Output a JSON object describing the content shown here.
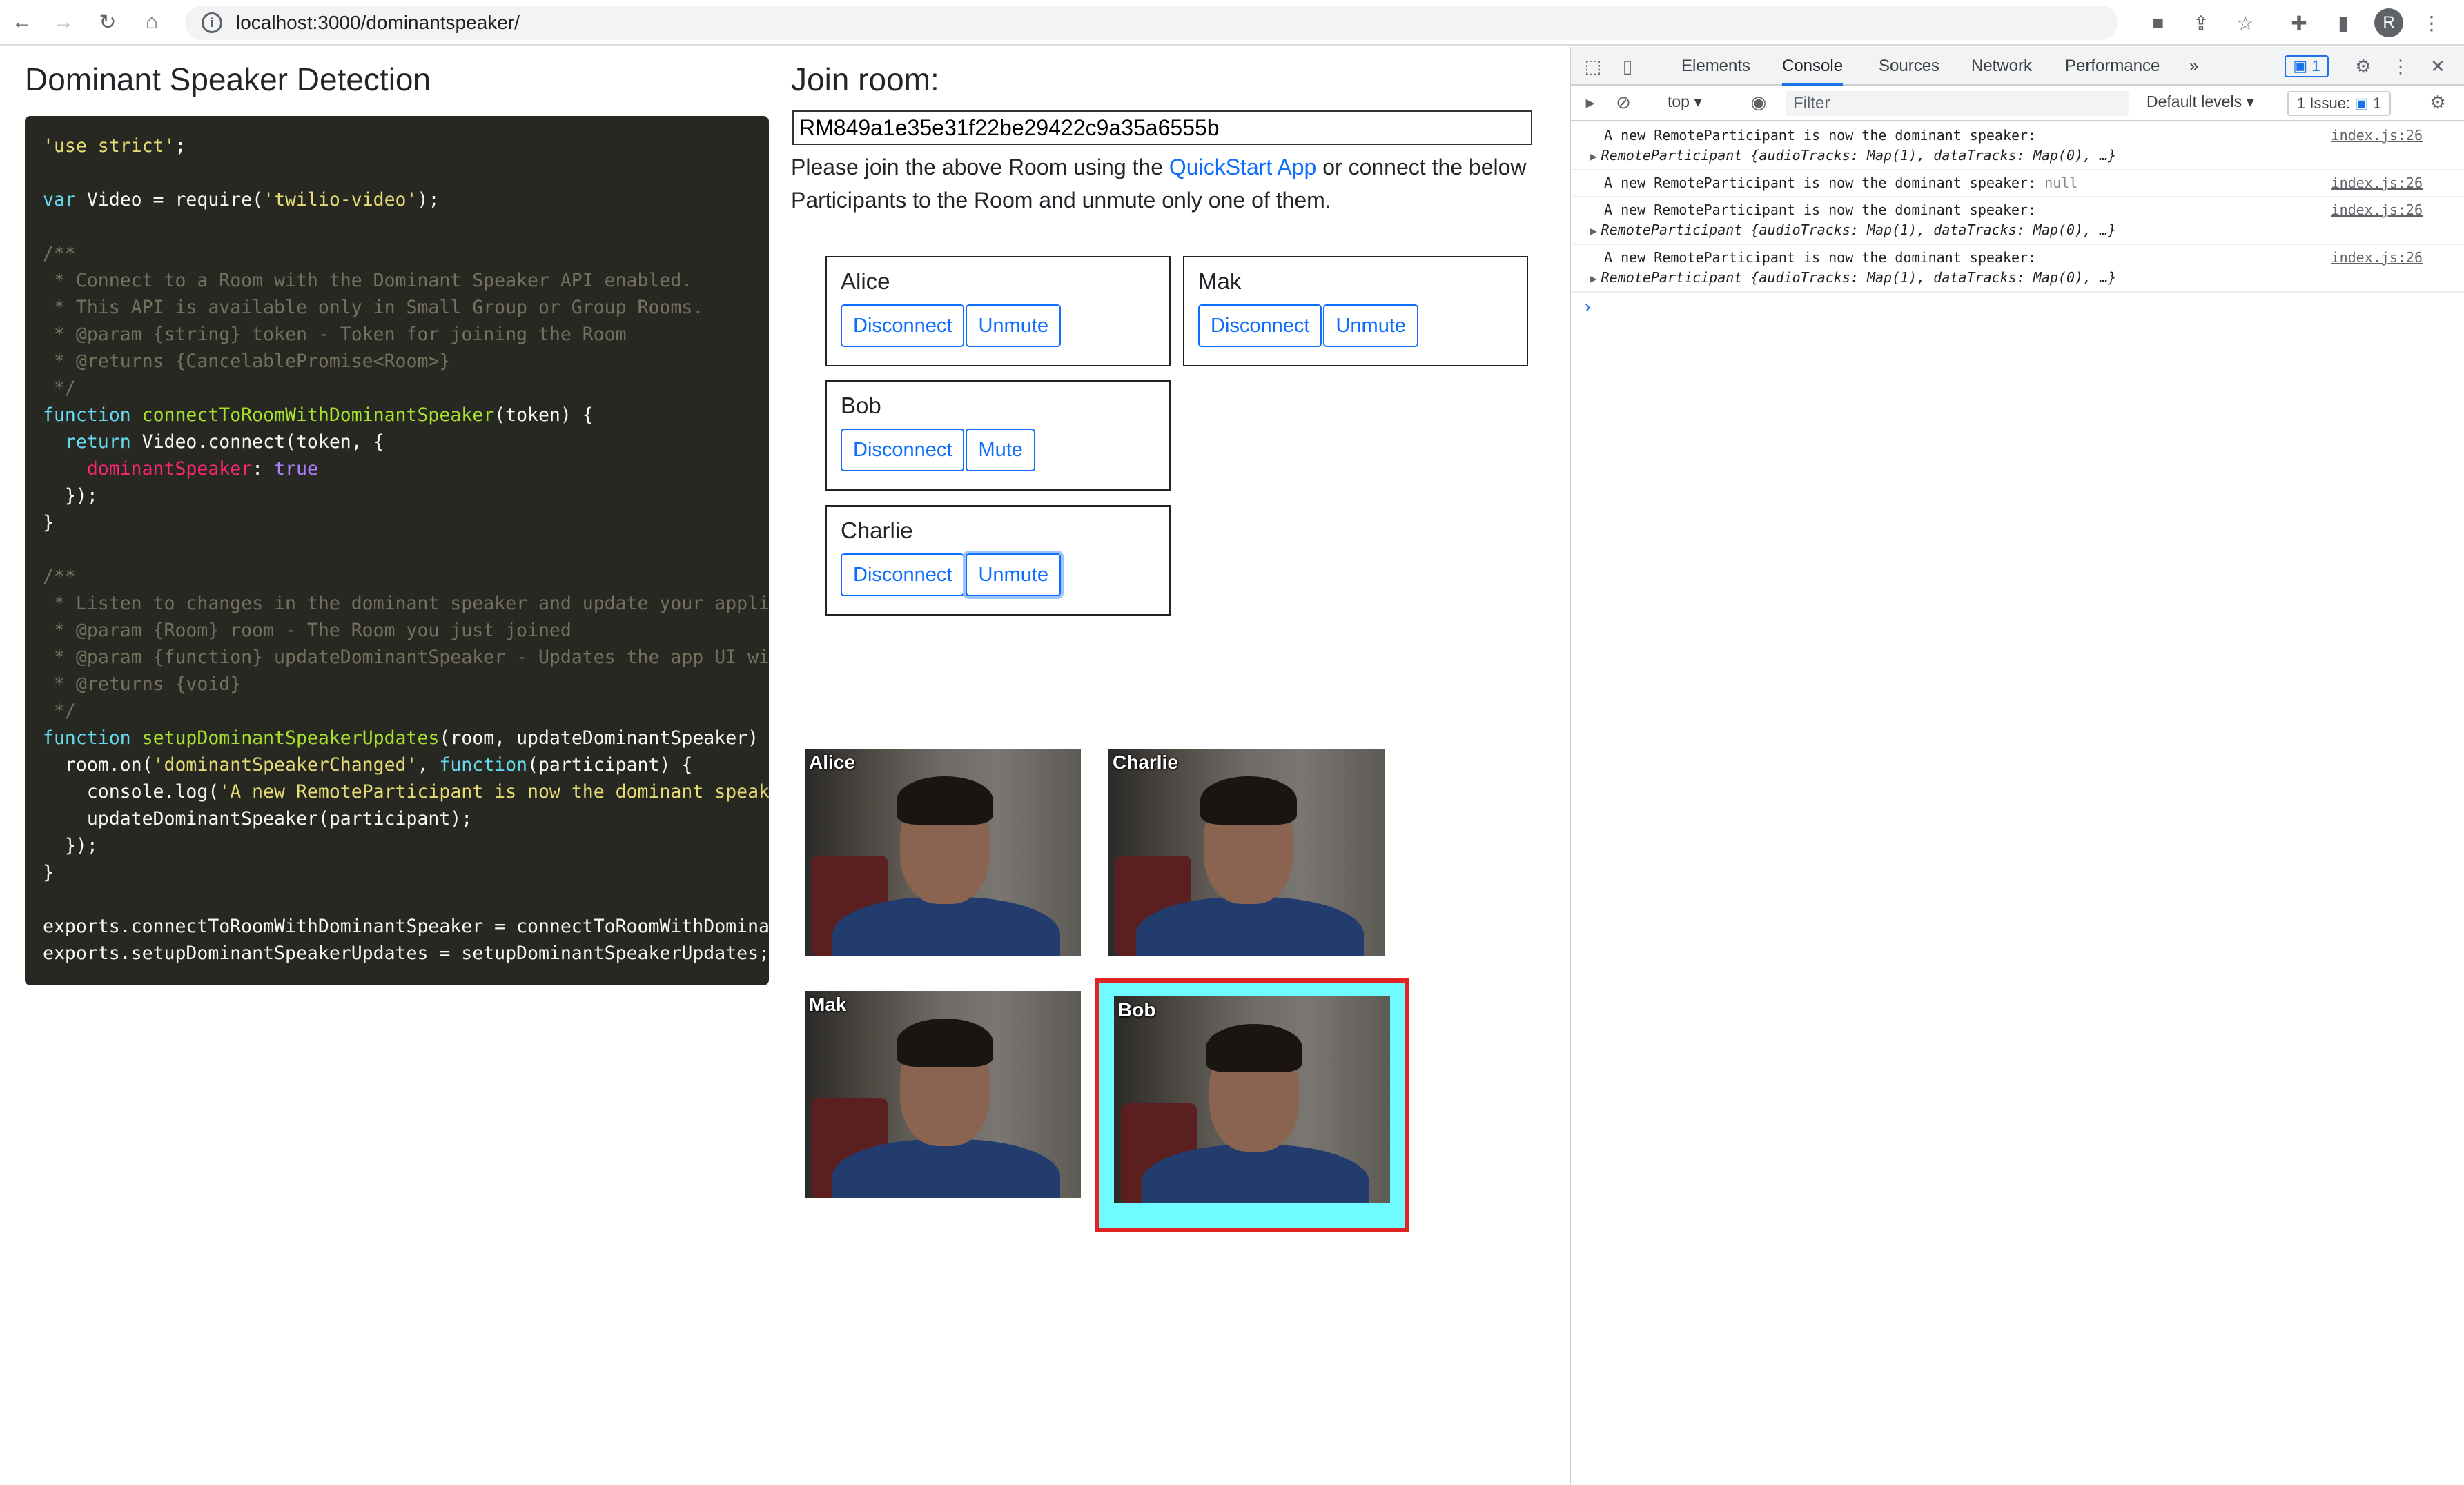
{
  "browser": {
    "url": "localhost:3000/dominantspeaker/",
    "avatar_letter": "R"
  },
  "page": {
    "title": "Dominant Speaker Detection",
    "join_title": "Join room:",
    "room_sid": "RM849a1e35e31f22be29422c9a35a6555b",
    "instructions_pre": "Please join the above Room using the ",
    "instructions_link": "QuickStart App",
    "instructions_post": " or connect the below Participants to the Room and unmute only one of them."
  },
  "participants": [
    {
      "name": "Alice",
      "disconnect_label": "Disconnect",
      "audio_label": "Unmute"
    },
    {
      "name": "Mak",
      "disconnect_label": "Disconnect",
      "audio_label": "Unmute"
    },
    {
      "name": "Bob",
      "disconnect_label": "Disconnect",
      "audio_label": "Mute"
    },
    {
      "name": "Charlie",
      "disconnect_label": "Disconnect",
      "audio_label": "Unmute"
    }
  ],
  "videos": [
    {
      "label": "Alice"
    },
    {
      "label": "Charlie"
    },
    {
      "label": "Mak"
    },
    {
      "label": "Bob",
      "dominant": true
    }
  ],
  "devtools": {
    "tabs": [
      "Elements",
      "Console",
      "Sources",
      "Network",
      "Performance"
    ],
    "active_tab": "Console",
    "more": "»",
    "context": "top",
    "filter_placeholder": "Filter",
    "levels": "Default levels",
    "issues_label": "1 Issue:",
    "issues_count": "1",
    "messages_badge": "1",
    "messages": [
      {
        "text": "A new RemoteParticipant is now the dominant speaker:",
        "obj": "RemoteParticipant {audioTracks: Map(1), dataTracks: Map(0), …}",
        "src": "index.js:26"
      },
      {
        "text": "A new RemoteParticipant is now the dominant speaker:",
        "value": "null",
        "src": "index.js:26"
      },
      {
        "text": "A new RemoteParticipant is now the dominant speaker:",
        "obj": "RemoteParticipant {audioTracks: Map(1), dataTracks: Map(0), …}",
        "src": "index.js:26"
      },
      {
        "text": "A new RemoteParticipant is now the dominant speaker:",
        "obj": "RemoteParticipant {audioTracks: Map(1), dataTracks: Map(0), …}",
        "src": "index.js:26"
      }
    ]
  }
}
